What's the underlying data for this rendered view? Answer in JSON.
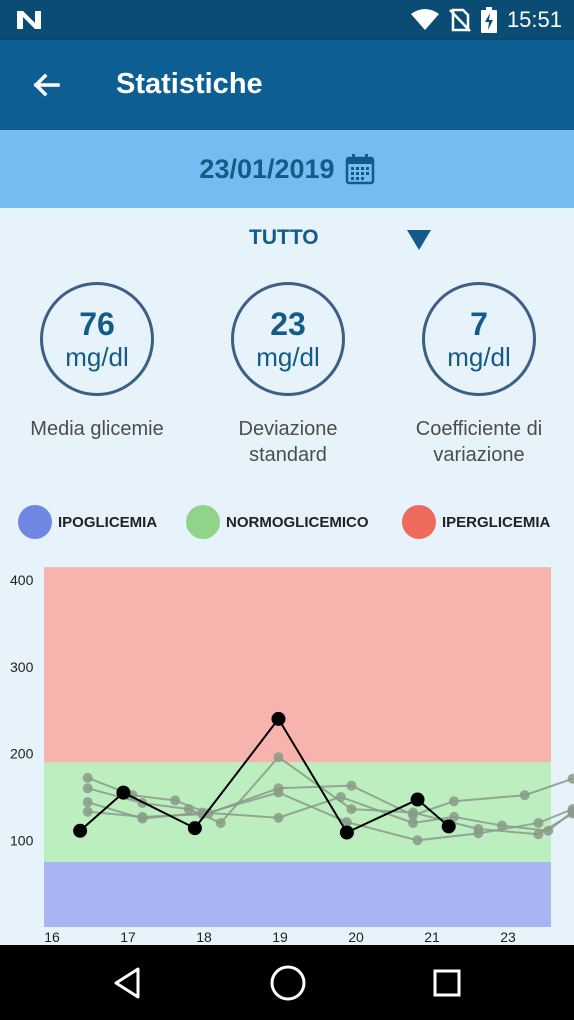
{
  "status_bar": {
    "time": "15:51",
    "left_icon": "n-notification-icon",
    "icons": [
      "wifi-icon",
      "no-sim-icon",
      "battery-charging-icon"
    ]
  },
  "app_bar": {
    "title": "Statistiche",
    "back_icon": "arrow-left-icon"
  },
  "date_bar": {
    "date": "23/01/2019",
    "icon": "calendar-icon"
  },
  "filter": {
    "selected": "TUTTO",
    "icon": "dropdown-triangle-icon"
  },
  "stats": [
    {
      "value": "76",
      "unit": "mg/dl",
      "caption_line1": "Media glicemie",
      "caption_line2": ""
    },
    {
      "value": "23",
      "unit": "mg/dl",
      "caption_line1": "Deviazione",
      "caption_line2": "standard"
    },
    {
      "value": "7",
      "unit": "mg/dl",
      "caption_line1": "Coefficiente di",
      "caption_line2": "variazione"
    }
  ],
  "legend": [
    {
      "label": "IPOGLICEMIA",
      "color": "#6f86e2"
    },
    {
      "label": "NORMOGLICEMICO",
      "color": "#8fd489"
    },
    {
      "label": "IPERGLICEMIA",
      "color": "#ee6a5d"
    }
  ],
  "colors": {
    "status_bar": "#0a4c74",
    "app_bar": "#0d5f93",
    "date_bar": "#74bdf2",
    "accent": "#155b8a",
    "background": "#e6f3fb"
  },
  "chart_data": {
    "type": "line",
    "x_ticks": [
      "16",
      "17",
      "18",
      "19",
      "20",
      "21",
      "23"
    ],
    "y_ticks": [
      "100",
      "200",
      "300",
      "400"
    ],
    "ylim": [
      0,
      420
    ],
    "bands": [
      {
        "name": "IPOGLICEMIA",
        "from": 0,
        "to": 75,
        "color": "#a9b5f3"
      },
      {
        "name": "NORMOGLICEMICO",
        "from": 75,
        "to": 190,
        "color": "#bdeec0"
      },
      {
        "name": "IPERGLICEMIA",
        "from": 190,
        "to": 415,
        "color": "#f7b3ae"
      }
    ],
    "main_series": {
      "x": [
        16.37,
        16.94,
        17.88,
        18.98,
        19.88,
        20.81,
        21.22
      ],
      "y": [
        111,
        155,
        114,
        240,
        109,
        147,
        116
      ]
    },
    "background_series": [
      {
        "x": [
          16.47,
          17.06,
          17.62,
          18.06,
          18.98,
          19.94,
          20.75,
          21.29,
          22.22,
          22.85
        ],
        "y": [
          172,
          152,
          146,
          131,
          160,
          163,
          129,
          145,
          152,
          171
        ]
      },
      {
        "x": [
          16.47,
          17.19,
          17.8,
          18.22,
          18.98,
          19.94,
          20.75,
          21.61,
          22.4,
          22.85
        ],
        "y": [
          160,
          143,
          136,
          120,
          196,
          136,
          132,
          113,
          107,
          131
        ]
      },
      {
        "x": [
          16.47,
          17.19,
          17.98,
          18.98,
          19.8,
          20.75,
          21.29,
          21.92,
          22.53,
          22.85
        ],
        "y": [
          144,
          125,
          132,
          126,
          150,
          120,
          127,
          117,
          111,
          133
        ]
      },
      {
        "x": [
          16.47,
          17.19,
          17.98,
          18.98,
          19.88,
          20.81,
          21.61,
          22.4,
          22.85
        ],
        "y": [
          133,
          127,
          130,
          155,
          121,
          100,
          108,
          120,
          136
        ]
      }
    ]
  }
}
